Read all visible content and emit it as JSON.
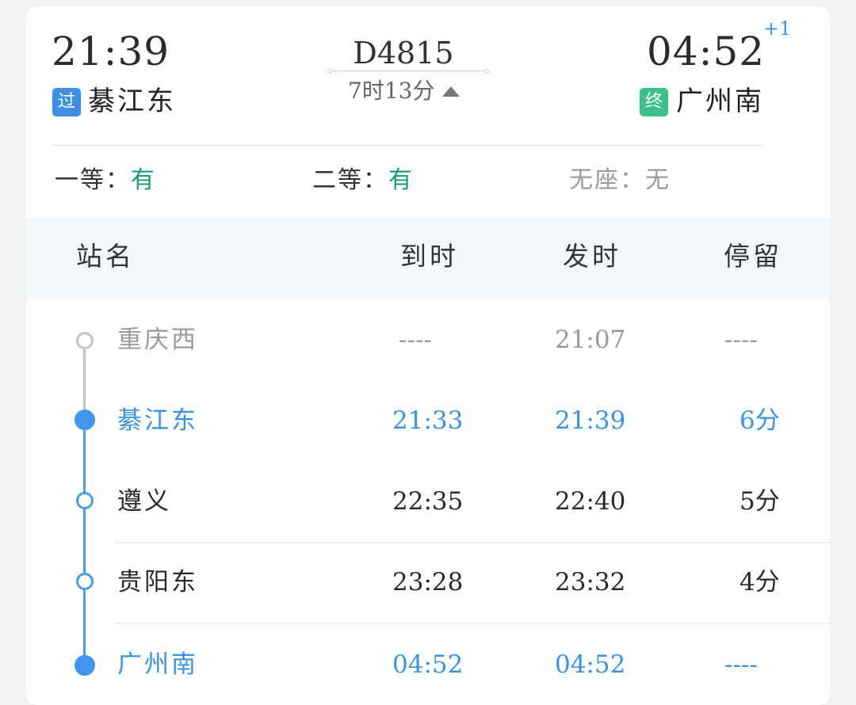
{
  "header": {
    "depart_time": "21:39",
    "depart_badge": "过",
    "depart_station": "綦江东",
    "train_no": "D4815",
    "duration": "7时13分",
    "arrive_time": "04:52",
    "arrive_day_offset": "+1",
    "arrive_badge": "终",
    "arrive_station": "广州南",
    "colors": {
      "pass_badge": "#3d8fe3",
      "end_badge": "#3cc18c"
    }
  },
  "seats": [
    {
      "label": "一等：",
      "value": "有"
    },
    {
      "label": "二等：",
      "value": "有"
    },
    {
      "label": "无座：",
      "value": "无"
    }
  ],
  "table": {
    "columns": [
      "站名",
      "到时",
      "发时",
      "停留"
    ],
    "rows": [
      {
        "station": "重庆西",
        "arrive": "----",
        "depart": "21:07",
        "stop": "----",
        "state": "passed"
      },
      {
        "station": "綦江东",
        "arrive": "21:33",
        "depart": "21:39",
        "stop": "6分",
        "state": "boarding"
      },
      {
        "station": "遵义",
        "arrive": "22:35",
        "depart": "22:40",
        "stop": "5分",
        "state": "normal"
      },
      {
        "station": "贵阳东",
        "arrive": "23:28",
        "depart": "23:32",
        "stop": "4分",
        "state": "normal"
      },
      {
        "station": "广州南",
        "arrive": "04:52",
        "depart": "04:52",
        "stop": "----",
        "state": "alighting"
      }
    ]
  },
  "icons": {
    "expand": "caret-up-icon"
  }
}
